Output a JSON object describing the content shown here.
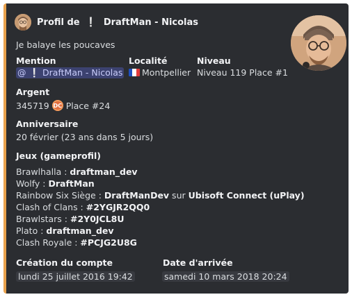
{
  "author": {
    "prefix": "Profil de",
    "excl": "❕",
    "name": "DraftMan - Nicolas"
  },
  "description": "Je balaye les poucaves",
  "fields": {
    "mention_label": "Mention",
    "mention_excl": "❕",
    "mention_value": "@",
    "mention_name": "DraftMan - Nicolas",
    "location_label": "Localité",
    "location_value": "Montpellier",
    "level_label": "Niveau",
    "level_value": "Niveau 119 Place #1",
    "money_label": "Argent",
    "money_amount": "345719",
    "money_place": "Place #24",
    "birthday_label": "Anniversaire",
    "birthday_value": "20 février (23 ans dans 5 jours)",
    "games_label": "Jeux (gameprofil)"
  },
  "games": [
    {
      "game": "Brawlhalla : ",
      "id": "draftman_dev"
    },
    {
      "game": "Wolfy : ",
      "id": "DraftMan"
    },
    {
      "game": "Rainbow Six Siège : ",
      "id": "DraftManDev",
      "mid": " sur ",
      "platform": "Ubisoft Connect (uPlay)"
    },
    {
      "game": "Clash of Clans : ",
      "id": "#2YGJR2QQ0"
    },
    {
      "game": "Brawlstars : ",
      "id": "#2Y0JCL8U"
    },
    {
      "game": "Plato : ",
      "id": "draftman_dev"
    },
    {
      "game": "Clash Royale : ",
      "id": "#PCJG2U8G"
    }
  ],
  "dates": {
    "created_label": "Création du compte",
    "created_value": "lundi 25 juillet 2016 19:42",
    "joined_label": "Date d'arrivée",
    "joined_value": "samedi 10 mars 2018 20:24"
  },
  "colors": {
    "accent": "#e9a24d",
    "background": "#2b2d31",
    "mention_bg": "#3c4270"
  },
  "icons": {
    "flag": "flag-france-icon",
    "coin": "coin-icon"
  }
}
